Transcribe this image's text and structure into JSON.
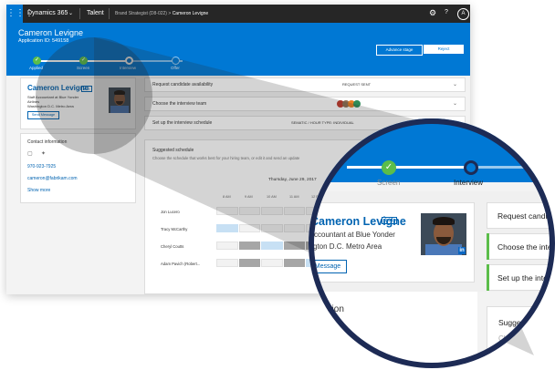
{
  "topbar": {
    "waffle": "⋮⋮⋮",
    "product": "Dynamics 365",
    "product_chevron": "⌄",
    "app": "Talent",
    "crumb_parent": "Brand Strategist (D8-022)",
    "crumb_sep": ">",
    "crumb_current": "Cameron Levigne",
    "gear": "⚙",
    "help": "?",
    "avatar": "A"
  },
  "candidate": {
    "name": "Cameron Levigne",
    "application_id": "Application ID: 549158",
    "actions": {
      "advance": "Advance stage",
      "reject": "Reject"
    },
    "stages": [
      {
        "label": "Applied",
        "state": "done"
      },
      {
        "label": "Screen",
        "state": "done"
      },
      {
        "label": "Interview",
        "state": "current"
      },
      {
        "label": "Offer",
        "state": "todo"
      }
    ]
  },
  "profile_card": {
    "name": "Cameron Levigne",
    "badge": "Ext",
    "title": "Staff Accountant at Blue Yonder",
    "company": "Airlines",
    "location": "Washington D.C. Metro Area",
    "send_message": "Send Message"
  },
  "contact": {
    "title": "Contact information",
    "phone": "970-923-7925",
    "email": "cameron@fabrikam.com",
    "show_more": "Show more"
  },
  "tasks": [
    {
      "label": "Request candidate availability",
      "right": "REQUEST SENT"
    },
    {
      "label": "Choose the interview team",
      "right": ""
    },
    {
      "label": "Set up the interview schedule",
      "right": "SEMATIC / HOUR     TYPE: INDIVIDUAL"
    }
  ],
  "schedule": {
    "title": "Suggested schedule",
    "subtitle": "Choose the schedule that works best for your hiring team, or edit it and send an update",
    "date": "Thursday, June 29, 2017",
    "hours": [
      "8 AM",
      "9 AM",
      "10 AM",
      "11 AM",
      "12 PM"
    ],
    "people": [
      {
        "name": "Jon Lucero",
        "slots": [
          "free",
          "free",
          "free",
          "free",
          "free"
        ]
      },
      {
        "name": "Tracy McCarthy",
        "slots": [
          "pick",
          "free",
          "free",
          "free",
          "free"
        ]
      },
      {
        "name": "Cheryl Coutts",
        "slots": [
          "free",
          "busy",
          "pick",
          "busy",
          "busy"
        ]
      },
      {
        "name": "Adam Pavich (Robert...",
        "slots": [
          "free",
          "busy",
          "free",
          "busy",
          "pick"
        ]
      }
    ]
  },
  "zoom": {
    "stage_screen": "Screen",
    "stage_interview": "Interview",
    "check": "✓",
    "name": "Cameron Levigne",
    "badge": "Ext",
    "title": "ccountant at Blue Yonder",
    "location": "gton D.C. Metro Area",
    "message_button": "Message",
    "contact_partial": "ormation",
    "row1": "Request candid",
    "row2": "Choose the inter",
    "row3": "Set up the inte",
    "suggested": "Sugges",
    "suggested_sub": "Ch"
  },
  "colors": {
    "accent": "#0078d4",
    "topbar": "#262626",
    "lens_ring": "#1d2b55",
    "success": "#5bbd4a"
  }
}
